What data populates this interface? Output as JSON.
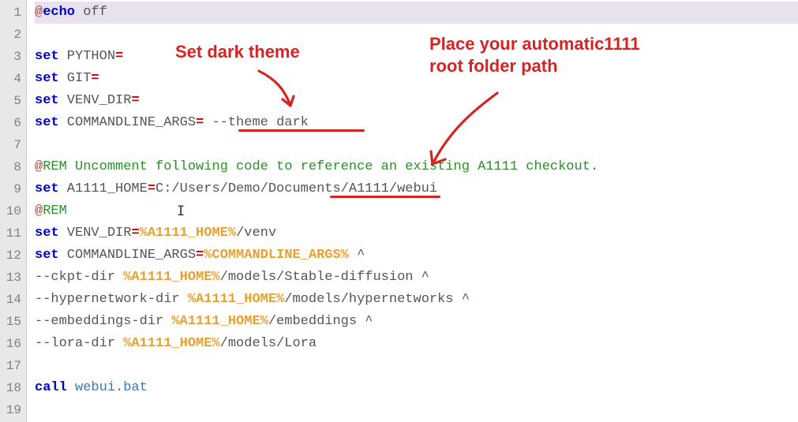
{
  "lines": [
    {
      "num": "1",
      "tokens": [
        [
          "at",
          "@"
        ],
        [
          "kw",
          "echo"
        ],
        [
          "plain",
          " off"
        ]
      ]
    },
    {
      "num": "2",
      "tokens": []
    },
    {
      "num": "3",
      "tokens": [
        [
          "kw",
          "set"
        ],
        [
          "plain",
          " PYTHON"
        ],
        [
          "op",
          "="
        ]
      ]
    },
    {
      "num": "4",
      "tokens": [
        [
          "kw",
          "set"
        ],
        [
          "plain",
          " GIT"
        ],
        [
          "op",
          "="
        ]
      ]
    },
    {
      "num": "5",
      "tokens": [
        [
          "kw",
          "set"
        ],
        [
          "plain",
          " VENV_DIR"
        ],
        [
          "op",
          "="
        ]
      ]
    },
    {
      "num": "6",
      "tokens": [
        [
          "kw",
          "set"
        ],
        [
          "plain",
          " COMMANDLINE_ARGS"
        ],
        [
          "op",
          "="
        ],
        [
          "plain",
          " --theme dark"
        ]
      ]
    },
    {
      "num": "7",
      "tokens": []
    },
    {
      "num": "8",
      "tokens": [
        [
          "at",
          "@"
        ],
        [
          "comment",
          "REM Uncomment following code to reference an existing A1111 checkout."
        ]
      ]
    },
    {
      "num": "9",
      "tokens": [
        [
          "kw",
          "set"
        ],
        [
          "plain",
          " A1111_HOME"
        ],
        [
          "op",
          "="
        ],
        [
          "plain",
          "C:/Users/Demo/Documents/A1111/webui"
        ]
      ]
    },
    {
      "num": "10",
      "tokens": [
        [
          "at",
          "@"
        ],
        [
          "comment",
          "REM"
        ]
      ]
    },
    {
      "num": "11",
      "tokens": [
        [
          "kw",
          "set"
        ],
        [
          "plain",
          " VENV_DIR"
        ],
        [
          "op",
          "="
        ],
        [
          "envref",
          "%A1111_HOME%"
        ],
        [
          "plain",
          "/venv"
        ]
      ]
    },
    {
      "num": "12",
      "tokens": [
        [
          "kw",
          "set"
        ],
        [
          "plain",
          " COMMANDLINE_ARGS"
        ],
        [
          "op",
          "="
        ],
        [
          "envref",
          "%COMMANDLINE_ARGS%"
        ],
        [
          "plain",
          " ^"
        ]
      ]
    },
    {
      "num": "13",
      "tokens": [
        [
          "plain",
          "--ckpt-dir "
        ],
        [
          "envref",
          "%A1111_HOME%"
        ],
        [
          "plain",
          "/models/Stable-diffusion ^"
        ]
      ]
    },
    {
      "num": "14",
      "tokens": [
        [
          "plain",
          "--hypernetwork-dir "
        ],
        [
          "envref",
          "%A1111_HOME%"
        ],
        [
          "plain",
          "/models/hypernetworks ^"
        ]
      ]
    },
    {
      "num": "15",
      "tokens": [
        [
          "plain",
          "--embeddings-dir "
        ],
        [
          "envref",
          "%A1111_HOME%"
        ],
        [
          "plain",
          "/embeddings ^"
        ]
      ]
    },
    {
      "num": "16",
      "tokens": [
        [
          "plain",
          "--lora-dir "
        ],
        [
          "envref",
          "%A1111_HOME%"
        ],
        [
          "plain",
          "/models/Lora"
        ]
      ]
    },
    {
      "num": "17",
      "tokens": []
    },
    {
      "num": "18",
      "tokens": [
        [
          "kw",
          "call"
        ],
        [
          "cmd",
          " webui.bat"
        ]
      ]
    },
    {
      "num": "19",
      "tokens": []
    }
  ],
  "annotations": {
    "anno1": "Set dark theme",
    "anno2": "Place your automatic1111\nroot folder path"
  }
}
